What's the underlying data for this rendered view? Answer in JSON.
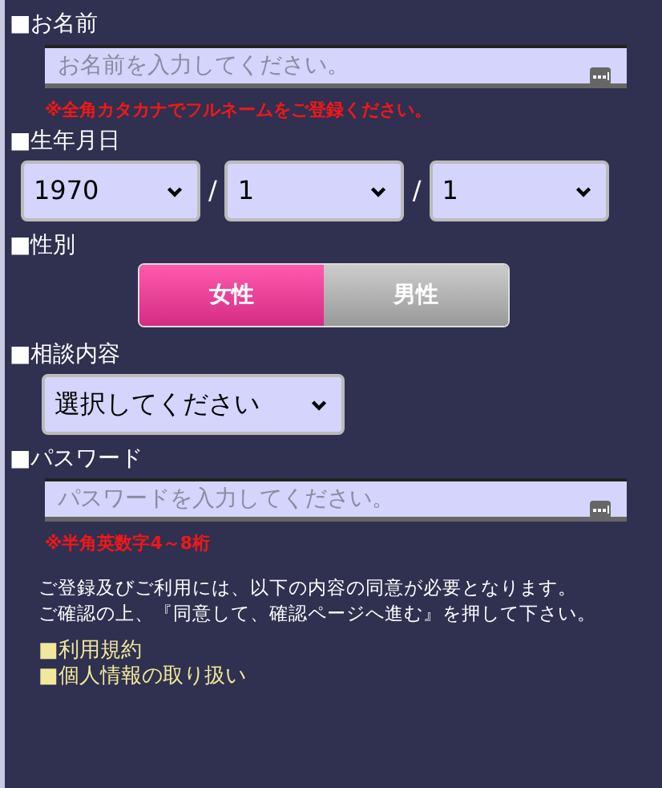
{
  "name": {
    "label": "■お名前",
    "placeholder": "お名前を入力してください。",
    "note": "※全角カタカナでフルネームをご登録ください。"
  },
  "birthday": {
    "label": "■生年月日",
    "year": "1970",
    "month": "1",
    "day": "1",
    "separators": [
      "/",
      "/"
    ]
  },
  "gender": {
    "label": "■性別",
    "options": [
      {
        "label": "女性",
        "selected": true
      },
      {
        "label": "男性",
        "selected": false
      }
    ]
  },
  "consultation": {
    "label": "■相談内容",
    "value": "選択してください"
  },
  "password": {
    "label": "■パスワード",
    "placeholder": "パスワードを入力してください。",
    "note": "※半角英数字4～8桁"
  },
  "agreement": {
    "lines": [
      "ご登録及びご利用には、以下の内容の同意が必要となります。",
      "ご確認の上、『同意して、確認ページへ進む』を押して下さい。"
    ]
  },
  "links": [
    "■利用規約",
    "■個人情報の取り扱い"
  ]
}
